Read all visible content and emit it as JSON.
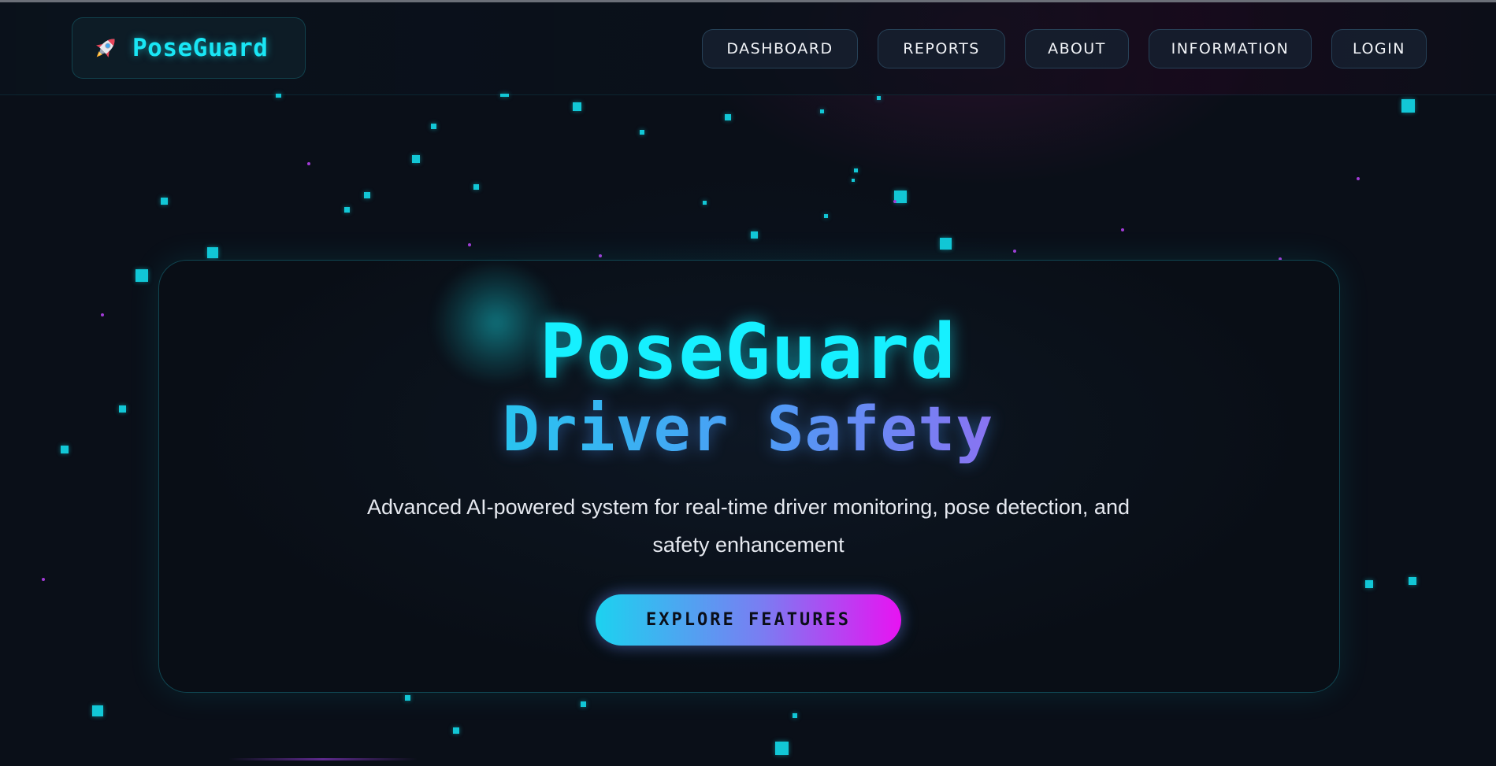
{
  "brand": {
    "name": "PoseGuard",
    "icon": "rocket-icon"
  },
  "nav": {
    "items": [
      {
        "label": "DASHBOARD"
      },
      {
        "label": "REPORTS"
      },
      {
        "label": "ABOUT"
      },
      {
        "label": "INFORMATION"
      },
      {
        "label": "LOGIN"
      }
    ]
  },
  "hero": {
    "title": "PoseGuard",
    "subtitle": "Driver Safety",
    "description": "Advanced AI-powered system for real-time driver monitoring, pose detection, and safety enhancement",
    "cta_label": "EXPLORE FEATURES"
  },
  "colors": {
    "background": "#0a0f18",
    "accent_cyan": "#16f0ff",
    "accent_magenta": "#e813f2",
    "particle_cyan": "#12c7d6",
    "particle_purple": "#a23bd6"
  }
}
